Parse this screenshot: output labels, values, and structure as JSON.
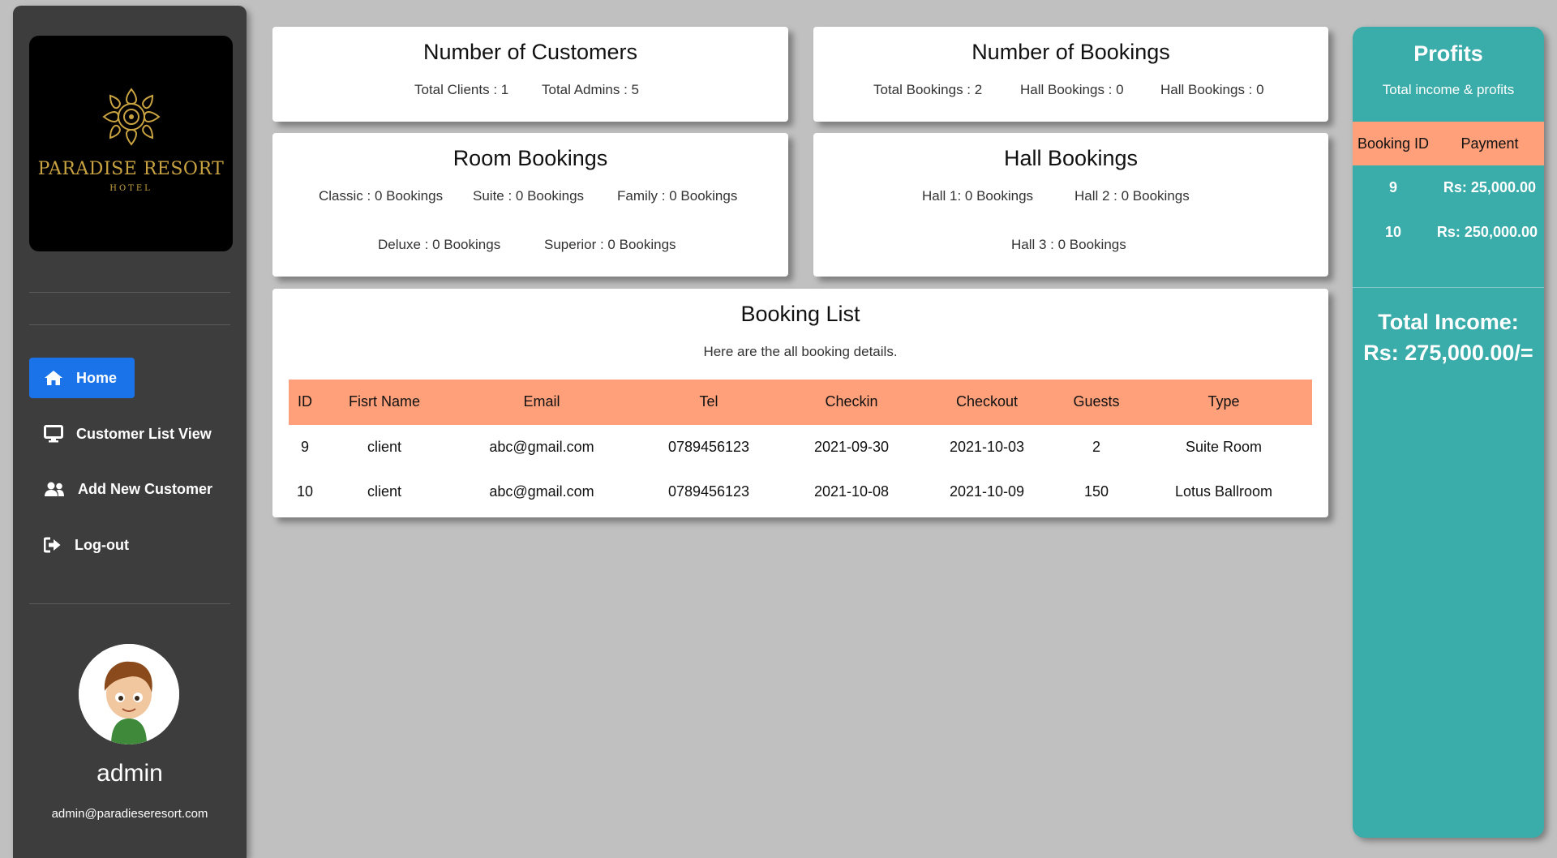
{
  "sidebar": {
    "logo": {
      "name": "PARADISE RESORT",
      "sub": "HOTEL"
    },
    "nav": [
      {
        "label": "Home",
        "icon": "home-icon"
      },
      {
        "label": "Customer List View",
        "icon": "monitor-icon"
      },
      {
        "label": "Add New Customer",
        "icon": "users-icon"
      },
      {
        "label": "Log-out",
        "icon": "logout-icon"
      }
    ],
    "user": {
      "name": "admin",
      "email": "admin@paradieseresort.com"
    }
  },
  "customers_card": {
    "title": "Number of Customers",
    "clients": "Total Clients : 1",
    "admins": "Total Admins : 5"
  },
  "bookings_card": {
    "title": "Number of Bookings",
    "total": "Total Bookings : 2",
    "hall_a": "Hall Bookings : 0",
    "hall_b": "Hall Bookings : 0"
  },
  "room_card": {
    "title": "Room Bookings",
    "classic": "Classic : 0 Bookings",
    "suite": "Suite : 0 Bookings",
    "family": "Family : 0 Bookings",
    "deluxe": "Deluxe : 0 Bookings",
    "superior": "Superior : 0 Bookings"
  },
  "hall_card": {
    "title": "Hall Bookings",
    "hall1": "Hall 1: 0 Bookings",
    "hall2": "Hall 2 : 0 Bookings",
    "hall3": "Hall 3 : 0 Bookings"
  },
  "booking_list": {
    "title": "Booking List",
    "subtitle": "Here are the all booking details.",
    "columns": [
      "ID",
      "Fisrt Name",
      "Email",
      "Tel",
      "Checkin",
      "Checkout",
      "Guests",
      "Type"
    ],
    "rows": [
      [
        "9",
        "client",
        "abc@gmail.com",
        "0789456123",
        "2021-09-30",
        "2021-10-03",
        "2",
        "Suite Room"
      ],
      [
        "10",
        "client",
        "abc@gmail.com",
        "0789456123",
        "2021-10-08",
        "2021-10-09",
        "150",
        "Lotus Ballroom"
      ]
    ]
  },
  "profits": {
    "title": "Profits",
    "subtitle": "Total income & profits",
    "columns": [
      "Booking ID",
      "Payment"
    ],
    "rows": [
      [
        "9",
        "Rs: 25,000.00"
      ],
      [
        "10",
        "Rs: 250,000.00"
      ]
    ],
    "total_label": "Total Income:",
    "total_value": "Rs: 275,000.00/="
  },
  "colors": {
    "sidebar": "#3d3d3d",
    "active_nav": "#1a73e8",
    "table_header": "#ffa07a",
    "profits_panel": "#3aacaa",
    "logo_gold": "#c9a341"
  }
}
